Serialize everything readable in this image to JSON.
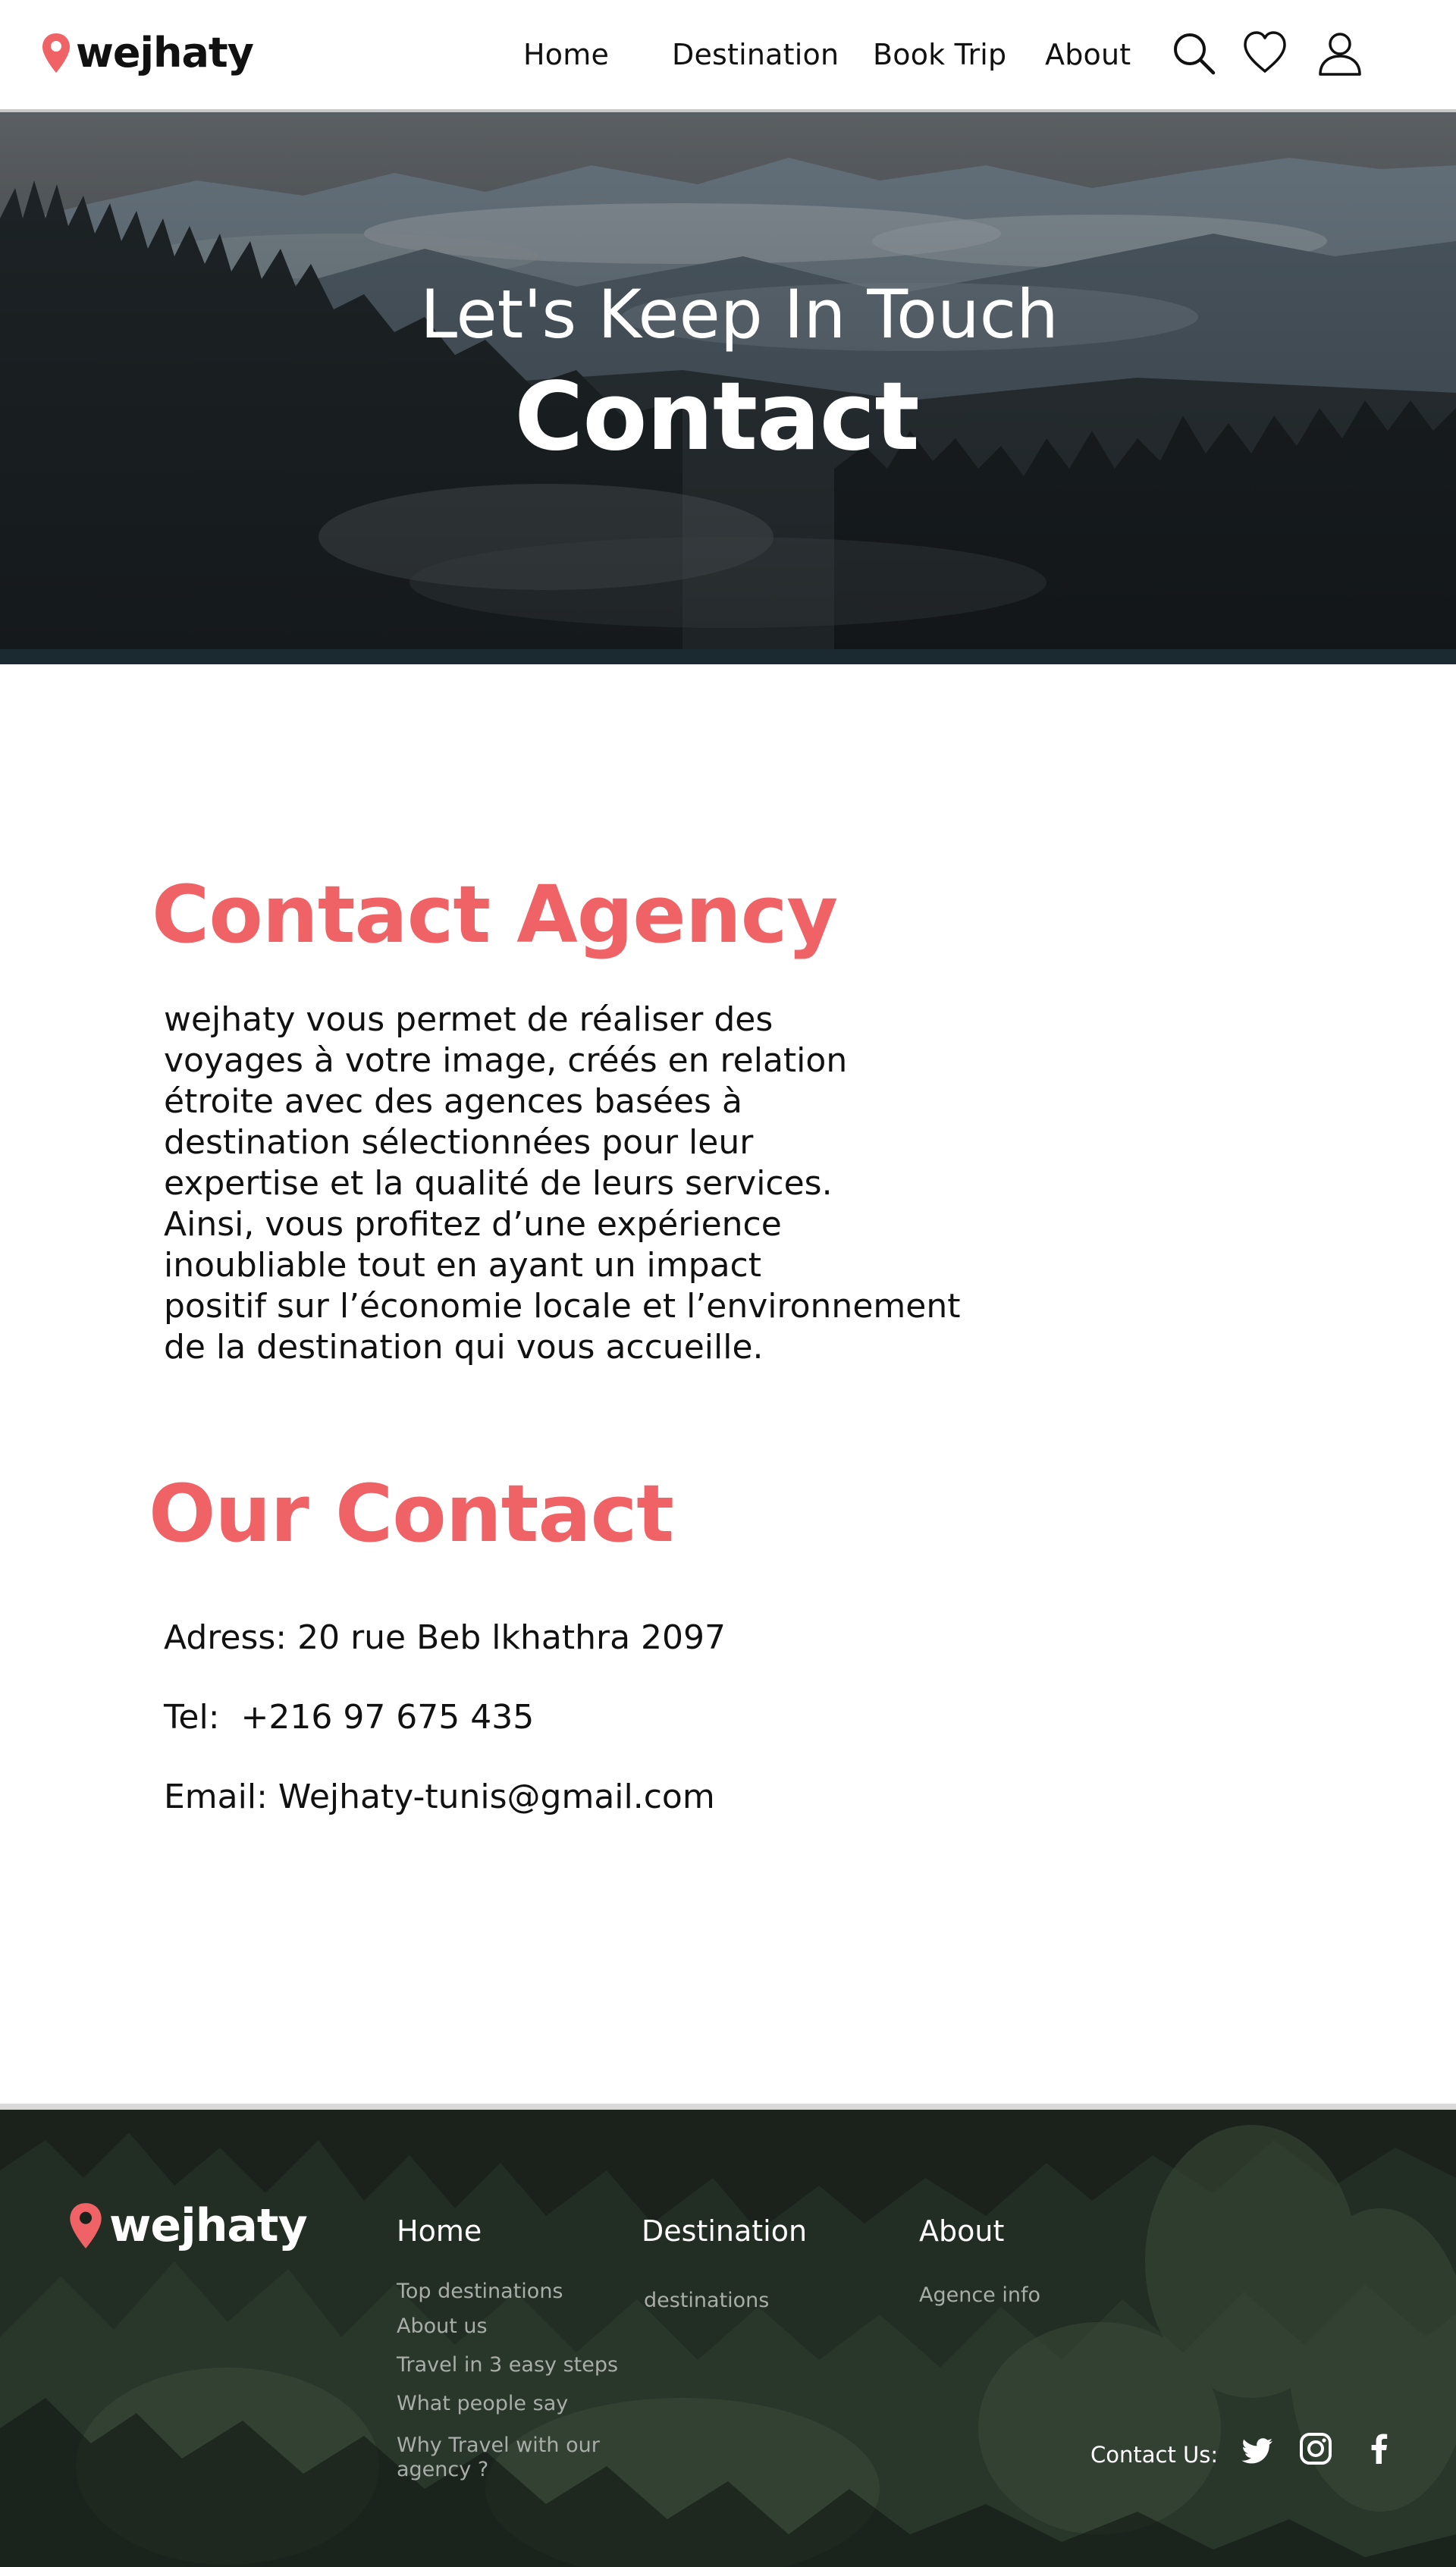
{
  "colors": {
    "accent": "#ef6367",
    "text": "#111111",
    "footer_link": "#a8ada8",
    "white": "#ffffff"
  },
  "nav": {
    "brand": "wejhaty",
    "links": [
      {
        "label": "Home"
      },
      {
        "label": "Destination"
      },
      {
        "label": "Book Trip"
      },
      {
        "label": "About"
      }
    ],
    "icons": [
      "search-icon",
      "heart-icon",
      "user-icon"
    ]
  },
  "hero": {
    "subtitle": "Let's Keep In Touch",
    "title": "Contact"
  },
  "agency": {
    "heading": "Contact Agency",
    "lines": [
      "wejhaty vous permet de réaliser des",
      "voyages à votre image, créés en relation",
      "étroite avec des agences basées à",
      "destination sélectionnées pour leur",
      "expertise et la qualité de leurs services.",
      "Ainsi, vous profitez d’une expérience",
      "inoubliable tout en ayant un impact",
      "positif sur l’économie locale et l’environnement",
      "de la destination qui vous accueille."
    ]
  },
  "contact": {
    "heading": "Our Contact",
    "address": "Adress: 20 rue Beb lkhathra 2097",
    "tel": "Tel:  +216 97 675 435",
    "email": "Email: Wejhaty-tunis@gmail.com"
  },
  "footer": {
    "brand": "wejhaty",
    "columns": [
      {
        "title": "Home",
        "links": [
          "Top destinations",
          "About us",
          "Travel in 3 easy steps",
          "What people say",
          "Why Travel with our",
          "agency ?"
        ]
      },
      {
        "title": "Destination",
        "links": [
          "destinations"
        ]
      },
      {
        "title": "About",
        "links": [
          "Agence info"
        ]
      }
    ],
    "contact_label": "Contact Us:",
    "social_icons": [
      "twitter-icon",
      "instagram-icon",
      "facebook-icon"
    ]
  }
}
